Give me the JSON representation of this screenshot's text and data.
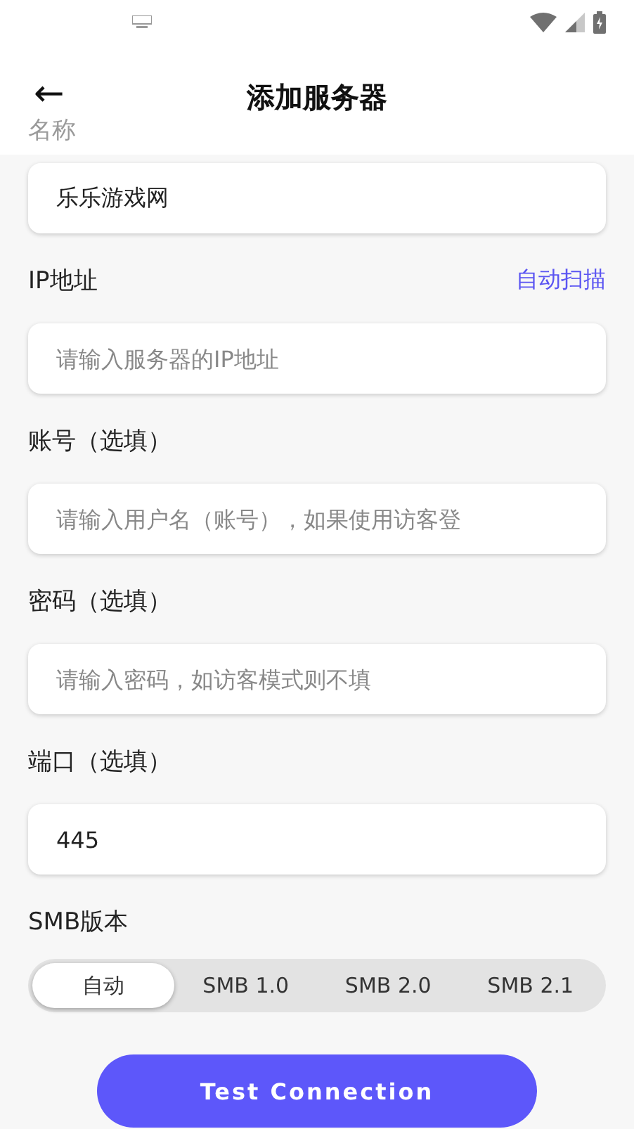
{
  "header": {
    "title": "添加服务器",
    "back": "←"
  },
  "fields": [
    {
      "label": "名称",
      "value": "乐乐游戏网"
    },
    {
      "label": "IP地址",
      "action": "自动扫描",
      "placeholder": "请输入服务器的IP地址"
    },
    {
      "label": "账号（选填）",
      "placeholder": "请输入用户名（账号），如果使用访客登"
    },
    {
      "label": "密码（选填）",
      "placeholder": "请输入密码，如访客模式则不填"
    },
    {
      "label": "端口（选填）",
      "value": "445"
    }
  ],
  "smb": {
    "label": "SMB版本",
    "options": [
      {
        "label": "自动",
        "selected": true
      },
      {
        "label": "SMB 1.0",
        "selected": false
      },
      {
        "label": "SMB 2.0",
        "selected": false
      },
      {
        "label": "SMB 2.1",
        "selected": false
      }
    ]
  },
  "button": "Test Connection"
}
